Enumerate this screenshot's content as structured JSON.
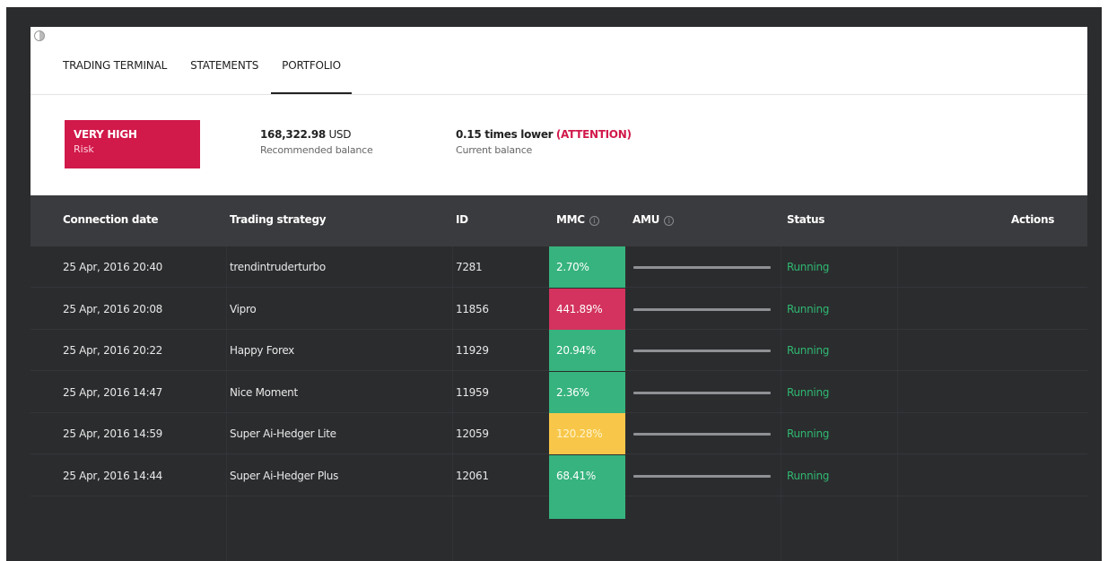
{
  "tabs": [
    {
      "label": "TRADING TERMINAL",
      "active": false
    },
    {
      "label": "STATEMENTS",
      "active": false
    },
    {
      "label": "PORTFOLIO",
      "active": true
    }
  ],
  "summary": {
    "risk_level": "VERY HIGH",
    "risk_label": "Risk",
    "recommended_value": "168,322.98",
    "recommended_currency": "USD",
    "recommended_label": "Recommended balance",
    "current_value": "0.15 times lower",
    "current_attention": "(ATTENTION)",
    "current_label": "Current balance"
  },
  "colors": {
    "risk_red": "#d1194a",
    "mmc_green": "#36b37e",
    "mmc_red": "#d3335e",
    "mmc_yellow": "#f8c749",
    "status_green": "#2fb871"
  },
  "table": {
    "headers": {
      "date": "Connection date",
      "strategy": "Trading strategy",
      "id": "ID",
      "mmc": "MMC",
      "amu": "AMU",
      "status": "Status",
      "actions": "Actions"
    },
    "rows": [
      {
        "date": "25 Apr, 2016 20:40",
        "strategy": "trendintruderturbo",
        "id": "7281",
        "mmc": "2.70%",
        "mmc_level": "green",
        "status": "Running"
      },
      {
        "date": "25 Apr, 2016 20:08",
        "strategy": "Vipro",
        "id": "11856",
        "mmc": "441.89%",
        "mmc_level": "red",
        "status": "Running"
      },
      {
        "date": "25 Apr, 2016 20:22",
        "strategy": "Happy Forex",
        "id": "11929",
        "mmc": "20.94%",
        "mmc_level": "green",
        "status": "Running"
      },
      {
        "date": "25 Apr, 2016 14:47",
        "strategy": "Nice Moment",
        "id": "11959",
        "mmc": "2.36%",
        "mmc_level": "green",
        "status": "Running"
      },
      {
        "date": "25 Apr, 2016 14:59",
        "strategy": "Super Ai-Hedger Lite",
        "id": "12059",
        "mmc": "120.28%",
        "mmc_level": "yellow",
        "status": "Running"
      },
      {
        "date": "25 Apr, 2016 14:44",
        "strategy": "Super Ai-Hedger Plus",
        "id": "12061",
        "mmc": "68.41%",
        "mmc_level": "green",
        "status": "Running"
      }
    ]
  }
}
